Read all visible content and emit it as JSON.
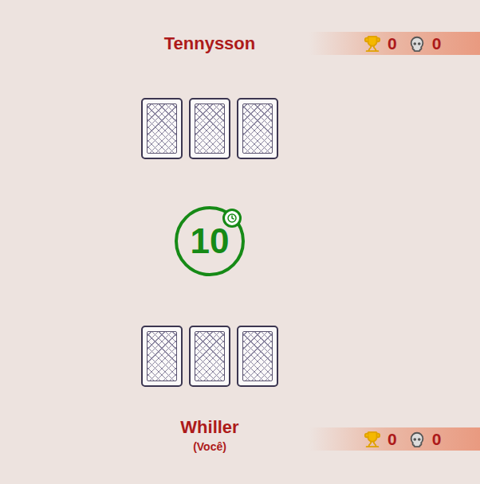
{
  "opponent": {
    "name": "Tennysson",
    "wins": "0",
    "losses": "0",
    "cards": [
      {
        "face_down": true
      },
      {
        "face_down": true
      },
      {
        "face_down": true
      }
    ]
  },
  "timer": {
    "value": "10"
  },
  "player": {
    "name": "Whiller",
    "tag": "(Você)",
    "wins": "0",
    "losses": "0",
    "cards": [
      {
        "face_down": true
      },
      {
        "face_down": true
      },
      {
        "face_down": true
      }
    ]
  }
}
